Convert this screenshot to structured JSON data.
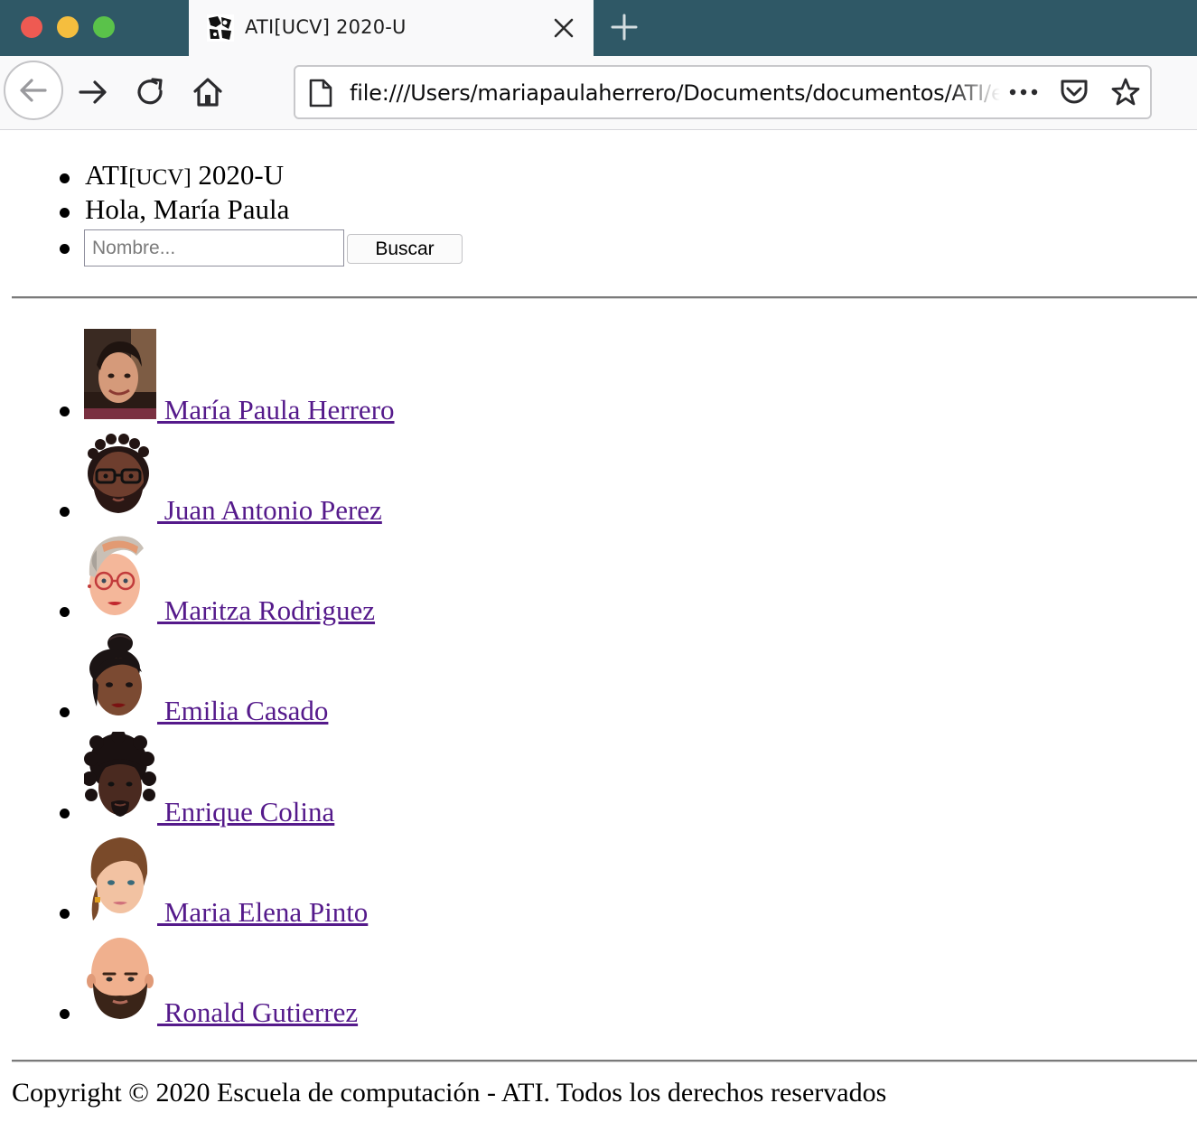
{
  "browser": {
    "tab_title": "ATI[UCV] 2020-U",
    "url": "file:///Users/mariapaulaherrero/Documents/documentos/ATI/ejercicio/index.html",
    "icons": [
      "back-arrow-icon",
      "forward-arrow-icon",
      "reload-icon",
      "home-icon",
      "page-icon",
      "more-icon",
      "pocket-icon",
      "star-icon",
      "close-icon",
      "plus-icon"
    ]
  },
  "header": {
    "brand_prefix": "ATI",
    "brand_small": "[UCV]",
    "brand_suffix": " 2020-U",
    "greeting": "Hola, María Paula",
    "search": {
      "placeholder": "Nombre...",
      "value": "",
      "button_label": "Buscar"
    }
  },
  "users": [
    {
      "name": "María Paula Herrero",
      "avatar": "photo-woman"
    },
    {
      "name": "Juan Antonio Perez",
      "avatar": "man-glasses-beard"
    },
    {
      "name": "Maritza Rodriguez",
      "avatar": "woman-glasses-grey-hair"
    },
    {
      "name": "Emilia Casado",
      "avatar": "woman-bun"
    },
    {
      "name": "Enrique Colina",
      "avatar": "man-curly-hair"
    },
    {
      "name": "Maria Elena Pinto",
      "avatar": "woman-ponytail"
    },
    {
      "name": "Ronald Gutierrez",
      "avatar": "bald-man-beard"
    }
  ],
  "footer": {
    "text": "Copyright © 2020 Escuela de computación - ATI. Todos los derechos reservados"
  }
}
